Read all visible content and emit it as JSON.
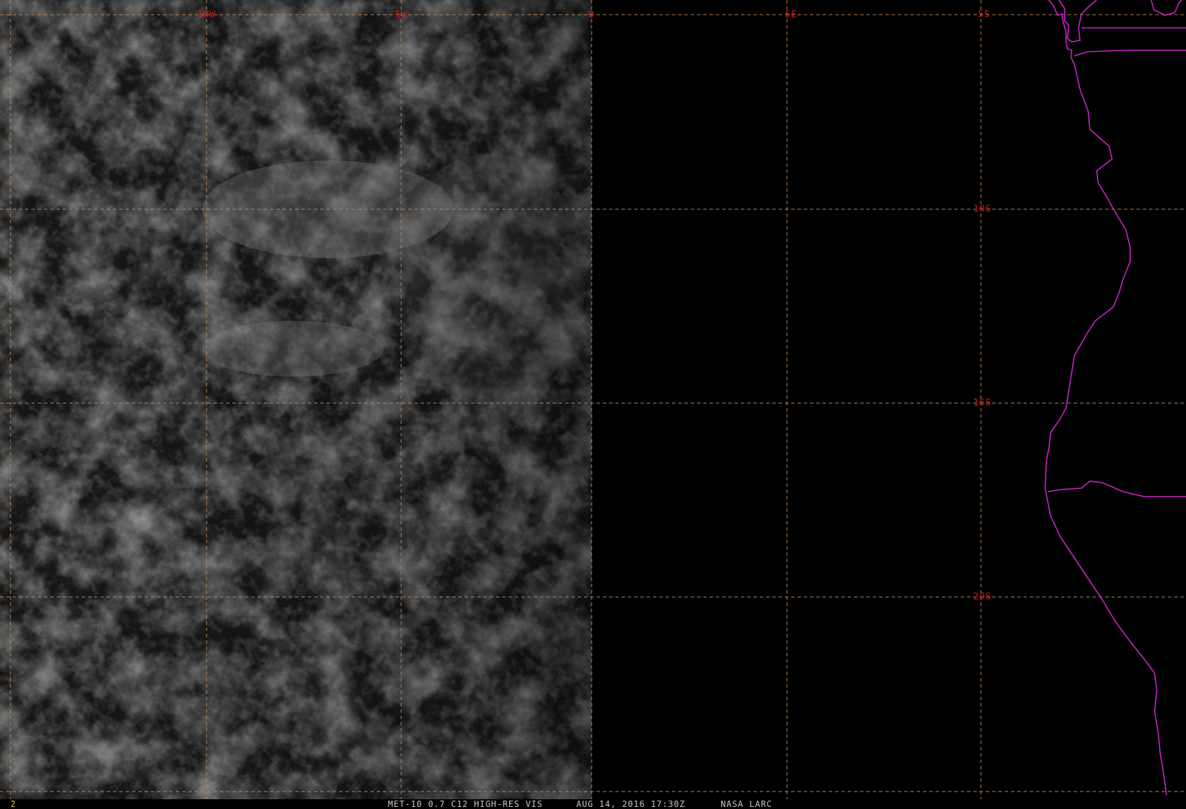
{
  "grid": {
    "longitude_labels": [
      "10W",
      "5W",
      "0",
      "5E"
    ],
    "latitude_labels": [
      "5S",
      "10S",
      "15S",
      "20S"
    ]
  },
  "status_bar": {
    "frame_number": "2",
    "product": "MET-10 0.7 C12 HIGH-RES VIS",
    "timestamp": "AUG 14, 2016 17:30Z",
    "source": "NASA LARC"
  },
  "colors": {
    "background": "#000000",
    "grid_line": "#b8865a",
    "grid_label": "#cc1a1a",
    "coastline": "#cc22cc",
    "status_text": "#c8c8c8",
    "frame_number": "#d8c020",
    "cloud": "#8a8a8a"
  }
}
